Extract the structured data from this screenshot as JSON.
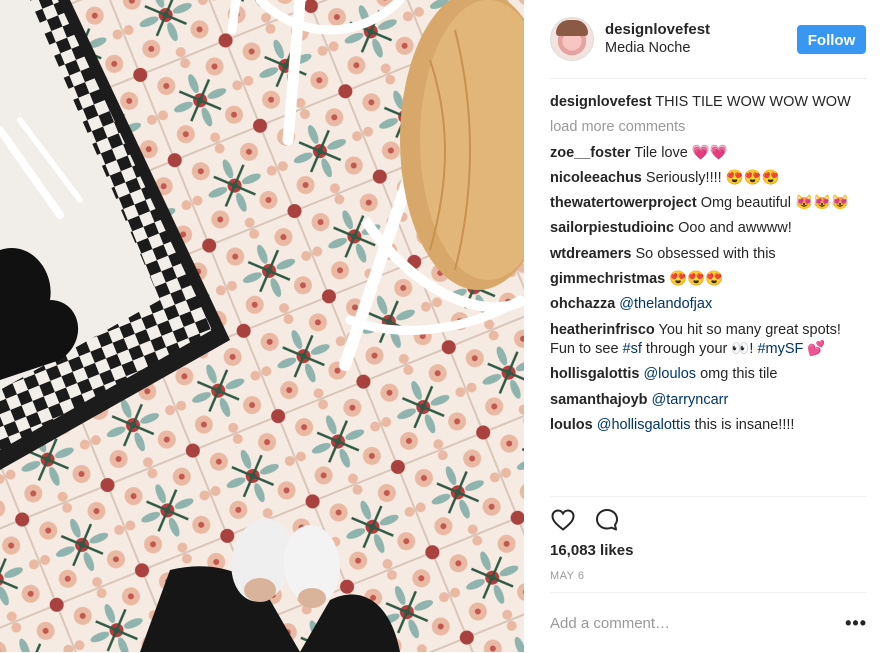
{
  "header": {
    "username": "designlovefest",
    "location": "Media Noche",
    "follow_label": "Follow"
  },
  "caption": {
    "user": "designlovefest",
    "text": "THIS TILE WOW WOW WOW"
  },
  "load_more": "load more comments",
  "comments": [
    {
      "user": "zoe__foster",
      "text": "Tile love 💗💗"
    },
    {
      "user": "nicoleeachus",
      "text": "Seriously!!!! 😍😍😍"
    },
    {
      "user": "thewatertowerproject",
      "text": "Omg beautiful 😻😻😻"
    },
    {
      "user": "sailorpiestudioinc",
      "text": "Ooo and awwww!"
    },
    {
      "user": "wtdreamers",
      "text": "So obsessed with this"
    },
    {
      "user": "gimmechristmas",
      "text": "😍😍😍"
    },
    {
      "user": "ohchazza",
      "mention": "@thelandofjax",
      "text": ""
    },
    {
      "user": "heatherinfrisco",
      "text_parts": [
        "You hit so many great spots! Fun to see ",
        "#sf",
        " through your 👀! ",
        "#mySF",
        " 💕"
      ]
    },
    {
      "user": "hollisgalottis",
      "mention": "@loulos",
      "text": " omg this tile"
    },
    {
      "user": "samanthajoyb",
      "mention": "@tarryncarr",
      "text": ""
    },
    {
      "user": "loulos",
      "mention": "@hollisgalottis",
      "text": " this is insane!!!!"
    }
  ],
  "likes": "16,083 likes",
  "date": "MAY 6",
  "add_comment_placeholder": "Add a comment…",
  "more_options": "•••",
  "icons": {
    "like": "heart-icon",
    "comment": "comment-bubble-icon",
    "options": "more-options-icon"
  },
  "colors": {
    "follow_button": "#3897f0",
    "mention": "#003569",
    "muted": "#999999",
    "text": "#262626"
  }
}
